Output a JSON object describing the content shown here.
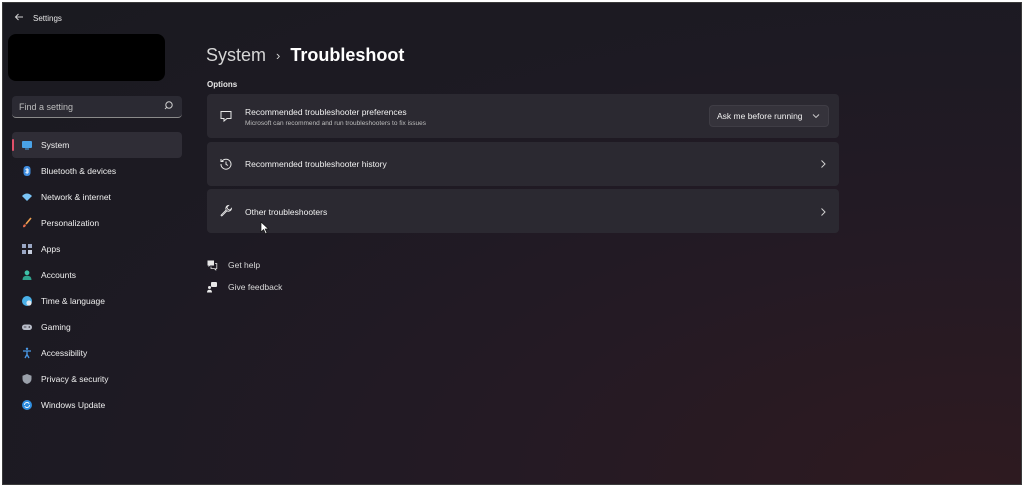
{
  "window": {
    "title": "Settings",
    "back_icon": "back-arrow-icon"
  },
  "search": {
    "placeholder": "Find a setting",
    "icon": "search-icon"
  },
  "sidebar": {
    "items": [
      {
        "label": "System",
        "icon": "system-icon",
        "active": true
      },
      {
        "label": "Bluetooth & devices",
        "icon": "bluetooth-icon"
      },
      {
        "label": "Network & internet",
        "icon": "network-icon"
      },
      {
        "label": "Personalization",
        "icon": "brush-icon"
      },
      {
        "label": "Apps",
        "icon": "apps-icon"
      },
      {
        "label": "Accounts",
        "icon": "accounts-icon"
      },
      {
        "label": "Time & language",
        "icon": "globe-clock-icon"
      },
      {
        "label": "Gaming",
        "icon": "gamepad-icon"
      },
      {
        "label": "Accessibility",
        "icon": "accessibility-icon"
      },
      {
        "label": "Privacy & security",
        "icon": "shield-icon"
      },
      {
        "label": "Windows Update",
        "icon": "update-icon"
      }
    ]
  },
  "header": {
    "parent": "System",
    "separator": "›",
    "current": "Troubleshoot"
  },
  "main": {
    "section_label": "Options",
    "cards": [
      {
        "title": "Recommended troubleshooter preferences",
        "description": "Microsoft can recommend and run troubleshooters to fix issues",
        "icon": "chat-bubble-icon",
        "control": {
          "type": "dropdown",
          "value": "Ask me before running"
        }
      },
      {
        "title": "Recommended troubleshooter history",
        "icon": "history-icon",
        "control": {
          "type": "chevron"
        }
      },
      {
        "title": "Other troubleshooters",
        "icon": "wrench-icon",
        "control": {
          "type": "chevron"
        }
      }
    ],
    "links": [
      {
        "label": "Get help",
        "icon": "help-chat-icon"
      },
      {
        "label": "Give feedback",
        "icon": "feedback-icon"
      }
    ]
  },
  "colors": {
    "accent": "#e0506a",
    "background": "#1d1a23",
    "card": "#2b2931"
  }
}
